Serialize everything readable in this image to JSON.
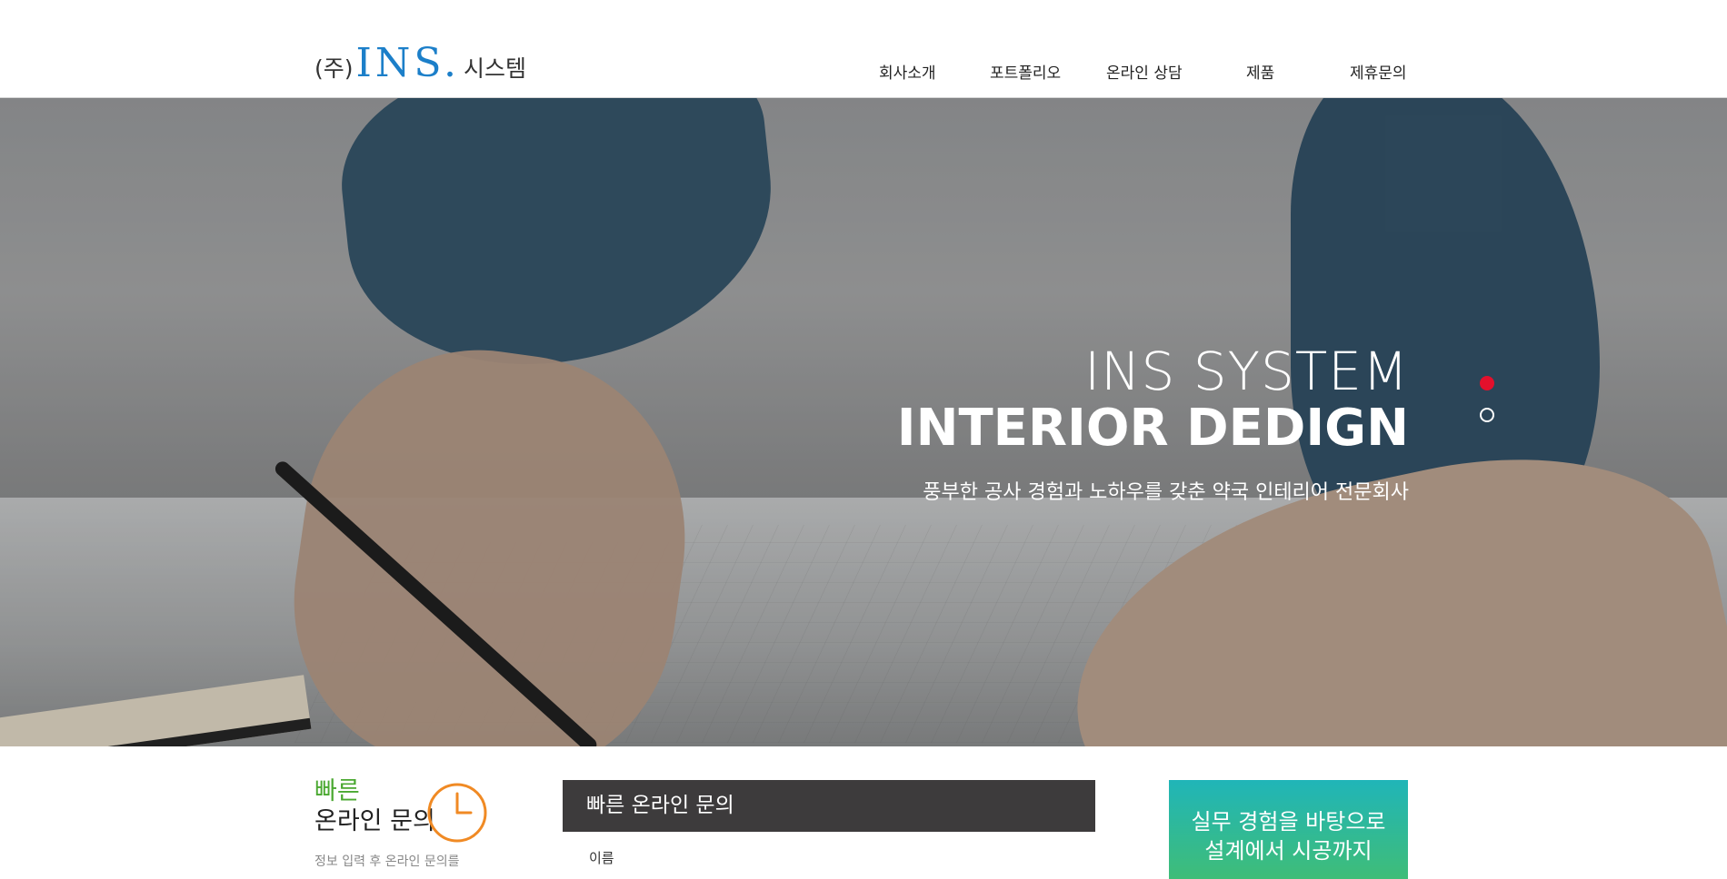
{
  "logo": {
    "prefix": "(주)",
    "brand": "INS",
    "dot": ".",
    "suffix": "시스템"
  },
  "nav": [
    "회사소개",
    "포트폴리오",
    "온라인 상담",
    "제품",
    "제휴문의"
  ],
  "hero": {
    "line1": "INS SYSTEM",
    "line2": "INTERIOR DEDIGN",
    "line3": "풍부한 공사 경험과 노하우를 갖춘 약국 인테리어 전문회사"
  },
  "quick": {
    "title_top": "빠른",
    "title_bottom": "온라인 문의",
    "desc": "정보 입력 후 온라인 문의를"
  },
  "form": {
    "header": "빠른 온라인 문의",
    "name_label": "이름"
  },
  "promo": {
    "line1": "실무 경험을 바탕으로",
    "line2": "설계에서 시공까지"
  },
  "colors": {
    "brand_blue": "#1c7fc9",
    "accent_red": "#e3102c",
    "green": "#4aa830",
    "orange": "#f08a24"
  }
}
